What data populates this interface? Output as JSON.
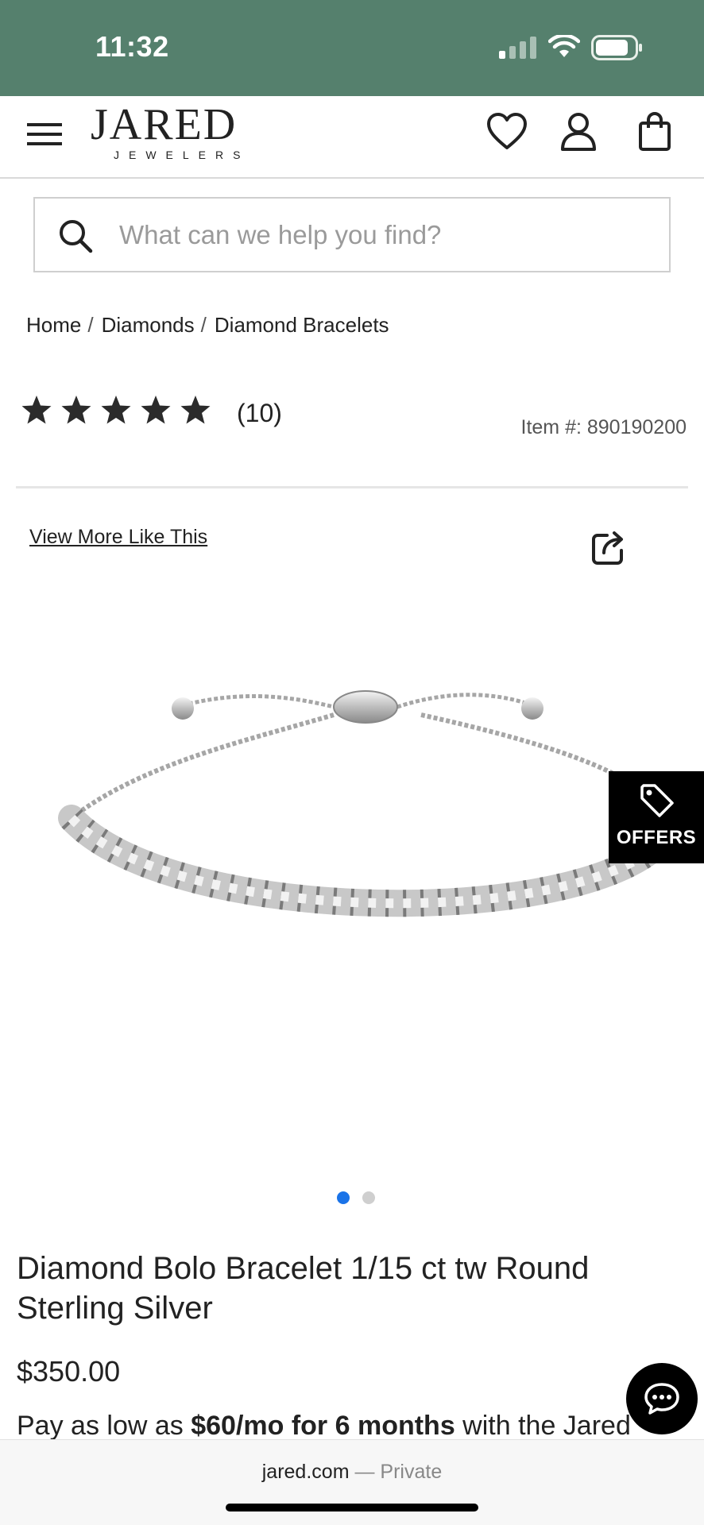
{
  "status_bar": {
    "time": "11:32"
  },
  "header": {
    "logo_main": "JARED",
    "logo_sub": "JEWELERS"
  },
  "search": {
    "placeholder": "What can we help you find?"
  },
  "breadcrumb": {
    "items": [
      "Home",
      "Diamonds",
      "Diamond Bracelets"
    ],
    "separator": "/"
  },
  "rating": {
    "stars": 5,
    "review_count": "(10)"
  },
  "item_number": "Item #: 890190200",
  "view_more_label": "View More Like This",
  "offers_label": "OFFERS",
  "carousel": {
    "total": 2,
    "active": 0
  },
  "product": {
    "title": "Diamond Bolo Bracelet 1/15 ct tw Round Sterling Silver",
    "price": "$350.00",
    "finance_prefix": "Pay as low as ",
    "finance_bold": "$60/mo for 6 months",
    "finance_suffix": " with the Jared"
  },
  "browser": {
    "url": "jared.com",
    "dash": " — ",
    "mode": "Private"
  },
  "colors": {
    "status_bar": "#55806d",
    "active_dot": "#1a73e8",
    "offers_bg": "#000000"
  }
}
